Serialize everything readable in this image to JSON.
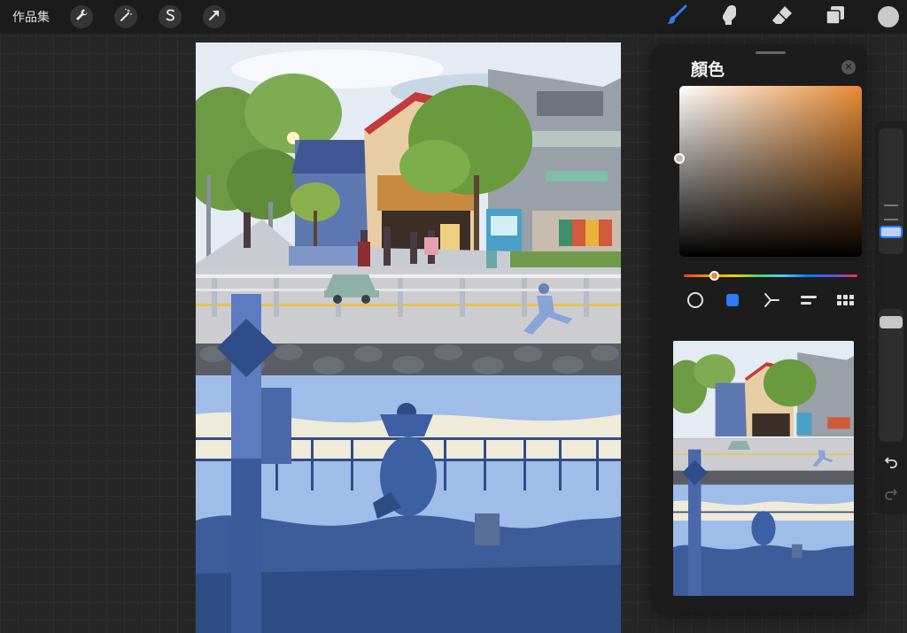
{
  "topbar": {
    "gallery_label": "作品集",
    "left_tools": [
      {
        "name": "actions",
        "icon": "wrench-icon"
      },
      {
        "name": "adjustments",
        "icon": "magic-wand-icon"
      },
      {
        "name": "selection",
        "icon": "selection-s-icon"
      },
      {
        "name": "transform",
        "icon": "arrow-cursor-icon"
      }
    ],
    "right_tools": [
      {
        "name": "brush",
        "icon": "brush-icon",
        "active": true
      },
      {
        "name": "smudge",
        "icon": "smudge-finger-icon",
        "active": false
      },
      {
        "name": "eraser",
        "icon": "eraser-icon",
        "active": false
      },
      {
        "name": "layers",
        "icon": "layers-icon",
        "active": false
      },
      {
        "name": "color",
        "icon": "color-swatch-icon",
        "active": false
      }
    ]
  },
  "color_panel": {
    "title": "顏色",
    "close_icon": "close-icon",
    "current_color": "#bdb7b0",
    "hue_color": "#e88a33",
    "modes": [
      {
        "name": "disc",
        "icon": "circle-icon",
        "active": false
      },
      {
        "name": "classic",
        "icon": "square-icon",
        "active": true
      },
      {
        "name": "harmony",
        "icon": "harmony-icon",
        "active": false
      },
      {
        "name": "value",
        "icon": "sliders-icon",
        "active": false
      },
      {
        "name": "palettes",
        "icon": "grid-icon",
        "active": false
      }
    ]
  },
  "sidebar": {
    "brush_size_icon": "brush-size-slider",
    "modify_icon": "square-outline-icon",
    "opacity_icon": "opacity-slider",
    "undo_icon": "undo-icon",
    "redo_icon": "redo-icon"
  },
  "colors": {
    "accent": "#2d7bf6",
    "panel_bg": "#1c1c1c",
    "canvas_bg": "#262626"
  }
}
